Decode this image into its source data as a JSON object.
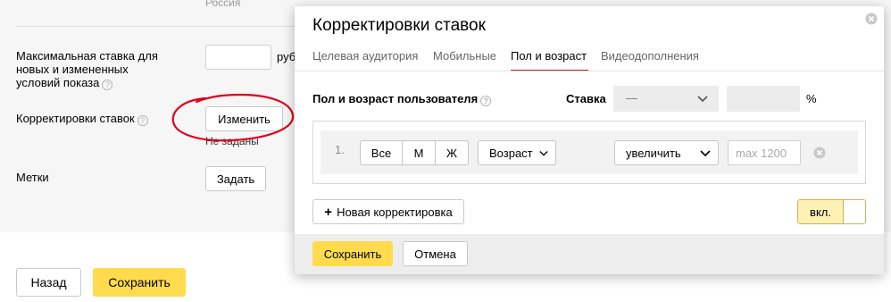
{
  "background_form": {
    "top_text": "Россия",
    "max_bid_label_line1": "Максимальная ставка для",
    "max_bid_label_line2": "новых и измененных",
    "max_bid_label_line3": "условий показа",
    "currency": "руб",
    "bid_adjustments_label": "Корректировки ставок",
    "change_button": "Изменить",
    "not_set_note": "Не заданы",
    "tags_label": "Метки",
    "set_button": "Задать",
    "back_button": "Назад",
    "save_button": "Сохранить"
  },
  "modal": {
    "title": "Корректировки ставок",
    "tabs": [
      {
        "label": "Целевая аудитория",
        "active": false
      },
      {
        "label": "Мобильные",
        "active": false
      },
      {
        "label": "Пол и возраст",
        "active": true
      },
      {
        "label": "Видеодополнения",
        "active": false
      }
    ],
    "section_label": "Пол и возраст пользователя",
    "rate_label": "Ставка",
    "rate_value": "—",
    "rate_unit": "%",
    "rows": [
      {
        "number": "1.",
        "gender_options": [
          "Все",
          "М",
          "Ж"
        ],
        "age_label": "Возраст",
        "direction": "увеличить",
        "max_placeholder": "max 1200"
      }
    ],
    "add_button": "Новая корректировка",
    "add_icon": "+",
    "toggle_label": "вкл.",
    "save_button": "Сохранить",
    "cancel_button": "Отмена"
  },
  "colors": {
    "accent_yellow": "#ffdb4d",
    "active_tab_underline": "#d2191c",
    "annotation_red": "#e0001b"
  }
}
